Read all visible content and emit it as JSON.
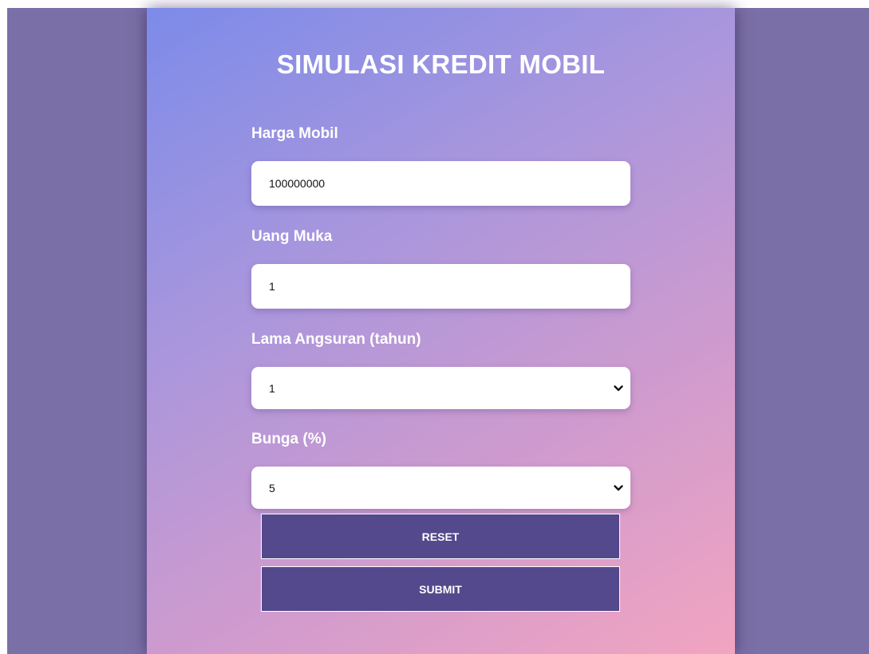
{
  "form": {
    "title": "SIMULASI KREDIT MOBIL",
    "harga_mobil": {
      "label": "Harga Mobil",
      "value": "100000000"
    },
    "uang_muka": {
      "label": "Uang Muka",
      "value": "1"
    },
    "lama_angsuran": {
      "label": "Lama Angsuran (tahun)",
      "selected": "1"
    },
    "bunga": {
      "label": "Bunga (%)",
      "selected": "5"
    },
    "reset_label": "RESET",
    "submit_label": "SUBMIT"
  },
  "colors": {
    "page_background": "#7a6fa6",
    "gradient_start": "#7c8be9",
    "gradient_end": "#f2a4c0",
    "button_background": "#54498c",
    "text": "#ffffff"
  },
  "icons": {
    "select_arrow": "chevron-down-icon"
  }
}
